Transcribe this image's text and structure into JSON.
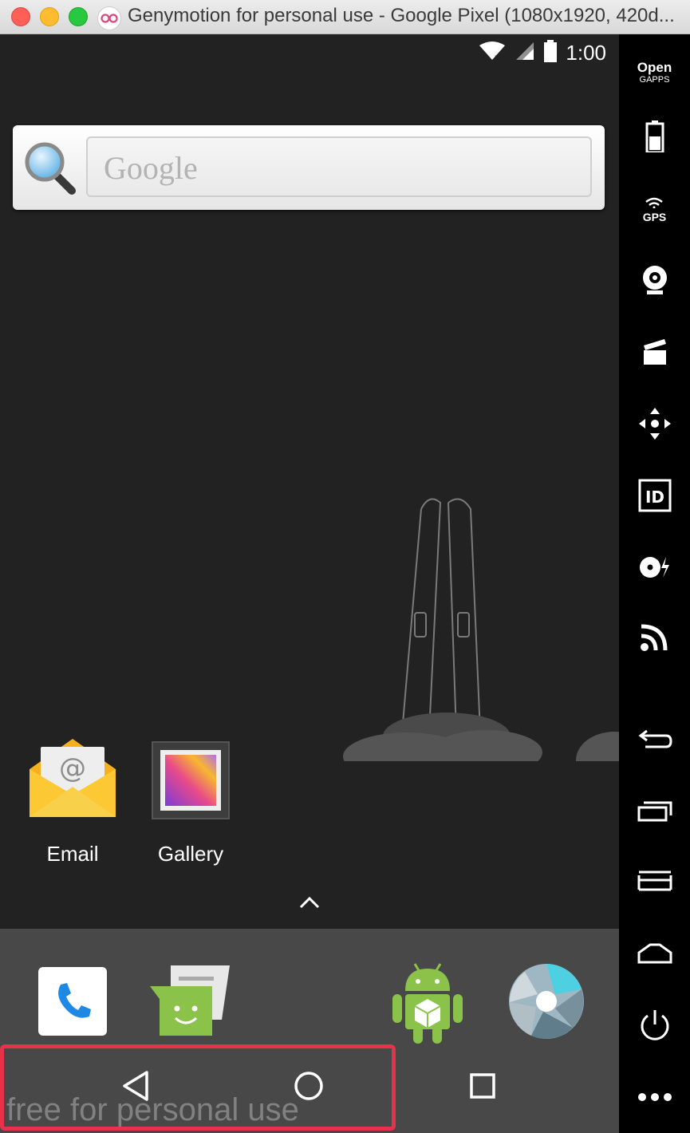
{
  "window": {
    "title": "Genymotion for personal use - Google Pixel (1080x1920, 420d..."
  },
  "status_bar": {
    "clock": "1:00",
    "icons": [
      "wifi-no-internet-icon",
      "cell-signal-icon",
      "battery-icon"
    ]
  },
  "search_widget": {
    "placeholder": "Google",
    "icon": "magnifier-icon"
  },
  "home_apps": [
    {
      "label": "Email",
      "icon": "email-icon"
    },
    {
      "label": "Gallery",
      "icon": "gallery-icon"
    }
  ],
  "dock": {
    "apps": [
      "phone-icon",
      "messaging-icon",
      "android-apk-icon",
      "camera-icon"
    ]
  },
  "nav_bar": {
    "buttons": [
      "back-icon",
      "home-icon",
      "recents-icon"
    ]
  },
  "watermark": "free for personal use",
  "sidebar": {
    "opengapps_line1": "Open",
    "opengapps_line2": "GAPPS",
    "gps_label": "GPS",
    "id_label": "ID",
    "tools": [
      "opengapps-icon",
      "battery-icon",
      "gps-icon",
      "webcam-icon",
      "capture-icon",
      "dpad-icon",
      "identifiers-icon",
      "disk-io-icon",
      "network-icon",
      "back-icon",
      "recents-icon",
      "menu-icon",
      "home-icon",
      "power-icon",
      "more-icon"
    ]
  },
  "colors": {
    "highlight": "#e8314a",
    "screen_bg": "#222222",
    "dock_bg": "#484848",
    "sidebar_bg": "#000000"
  }
}
